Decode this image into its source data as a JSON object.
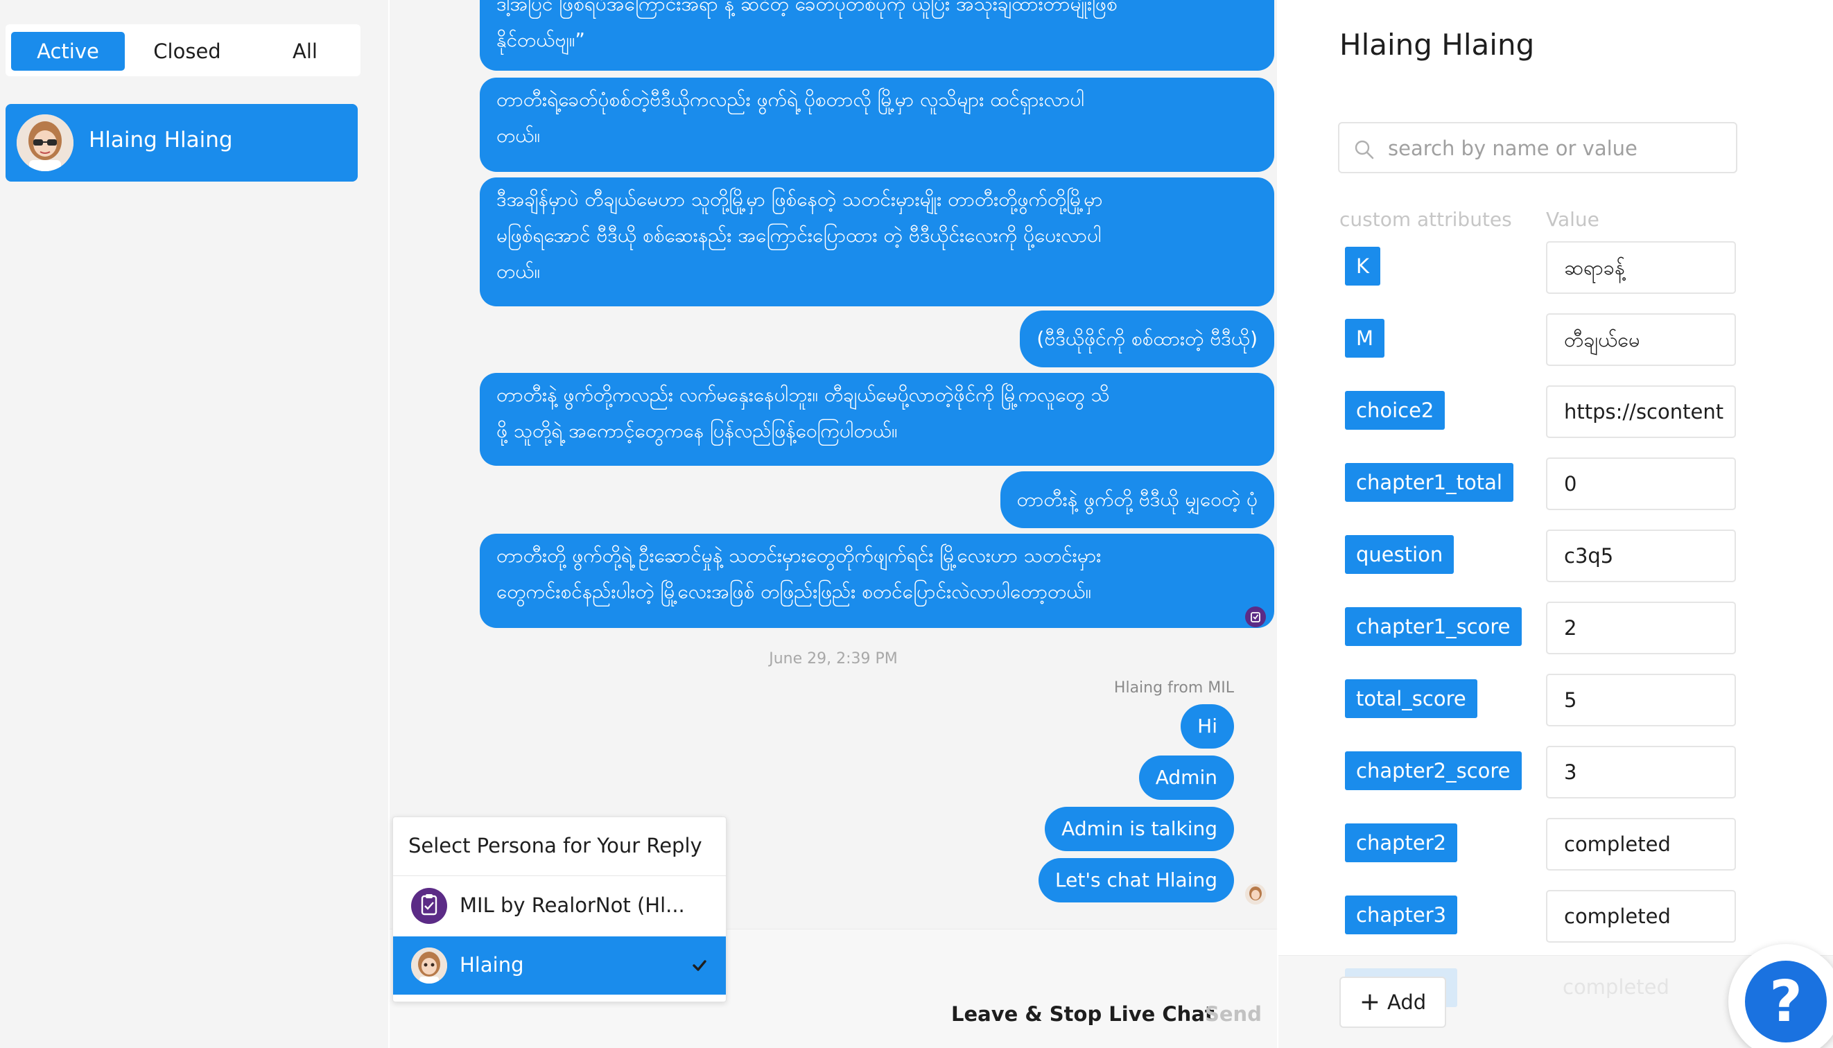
{
  "tabs": [
    {
      "label": "Active",
      "active": true
    },
    {
      "label": "Closed",
      "active": false
    },
    {
      "label": "All",
      "active": false
    }
  ],
  "conversation": {
    "name": "Hlaing Hlaing"
  },
  "messages": [
    {
      "lines": [
        "ဒါ့အပြင် ဖြစ်ရပ်အကြောင်းအရာ နဲ့ ဆင်တဲ့ ခေတ်ပုံတစ်ပုံကို ယူပြီး အသုံးချထားတာမျိုးဖြစ်",
        "နိုင်တယ်ဗျ။”"
      ]
    },
    {
      "lines": [
        "တာတီးရဲ့ခေတ်ပုံစစ်တဲ့ဗီဒီယိုကလည်း ဖွက်ရဲ့ ပိုစတာလို မြို့မှာ လူသိများ ထင်ရှားလာပါ",
        "တယ်။"
      ]
    },
    {
      "lines": [
        "ဒီအချိန်မှာပဲ တီချယ်မေဟာ သူတို့မြို့မှာ ဖြစ်နေတဲ့ သတင်းမှားမျိုး တာတီးတို့ဖွက်တို့မြို့မှာ",
        "မဖြစ်ရအောင် ဗီဒီယို စစ်ဆေးနည်း အကြောင်းပြောထား တဲ့ ဗီဒီယိုင်းလေးကို ပို့ပေးလာပါ",
        "တယ်။"
      ]
    },
    {
      "lines": [
        "(ဗီဒီယိုဖိုင်ကို စစ်ထားတဲ့ ဗီဒီယို)"
      ]
    },
    {
      "lines": [
        "တာတီးနဲ့ ဖွက်တို့ကလည်း လက်မနှေးနေပါဘူး။ တီချယ်မေပို့လာတဲ့ဖိုင်ကို မြို့ကလူတွေ သိ",
        "ဖို့ သူတို့ရဲ့ အကောင့်တွေကနေ ပြန်လည်ဖြန့်ဝေကြပါတယ်။"
      ]
    },
    {
      "lines": [
        "တာတီးနဲ့ ဖွက်တို့ ဗီဒီယို မျှဝေတဲ့ ပုံ"
      ]
    },
    {
      "lines": [
        "တာတီးတို့ ဖွက်တို့ရဲ့ ဦးဆောင်မှုနဲ့ သတင်းမှားတွေတိုက်ဖျက်ရင်း မြို့လေးဟာ သတင်းမှား",
        "တွေကင်းစင်နည်းပါးတဲ့ မြို့လေးအဖြစ် တဖြည်းဖြည်း စတင်ပြောင်းလဲလာပါတော့တယ်။"
      ]
    }
  ],
  "timestamp": "June 29, 2:39 PM",
  "sender_label": "Hlaing from MIL",
  "admin_messages": [
    "Hi",
    "Admin",
    "Admin is talking",
    "Let's chat Hlaing"
  ],
  "persona_popup": {
    "title": "Select Persona for Your Reply",
    "options": [
      {
        "label": "MIL by RealorNot (Hl...",
        "selected": false,
        "icon": "mil-logo-icon"
      },
      {
        "label": "Hlaing",
        "selected": true,
        "icon": "hlaing-avatar"
      }
    ]
  },
  "composer": {
    "leave_label": "Leave & Stop Live Chat",
    "send_label": "Send"
  },
  "contact": {
    "name": "Hlaing Hlaing"
  },
  "search": {
    "placeholder": "search by name or value"
  },
  "columns": {
    "attr": "custom attributes",
    "value": "Value"
  },
  "attributes": [
    {
      "key": "K",
      "value": "ဆရာခန့်"
    },
    {
      "key": "M",
      "value": "တီချယ်မေ"
    },
    {
      "key": "choice2",
      "value": "https://scontent"
    },
    {
      "key": "chapter1_total",
      "value": "0"
    },
    {
      "key": "question",
      "value": "c3q5"
    },
    {
      "key": "chapter1_score",
      "value": "2"
    },
    {
      "key": "total_score",
      "value": "5"
    },
    {
      "key": "chapter2_score",
      "value": "3"
    },
    {
      "key": "chapter2",
      "value": "completed"
    },
    {
      "key": "chapter3",
      "value": "completed"
    }
  ],
  "hidden_row": {
    "key": "chapter4",
    "value": "completed"
  },
  "add_label": "Add",
  "help_label": "?",
  "colors": {
    "accent": "#1a8cec",
    "mil_purple": "#5b2b86",
    "help_blue": "#1a72e0"
  }
}
